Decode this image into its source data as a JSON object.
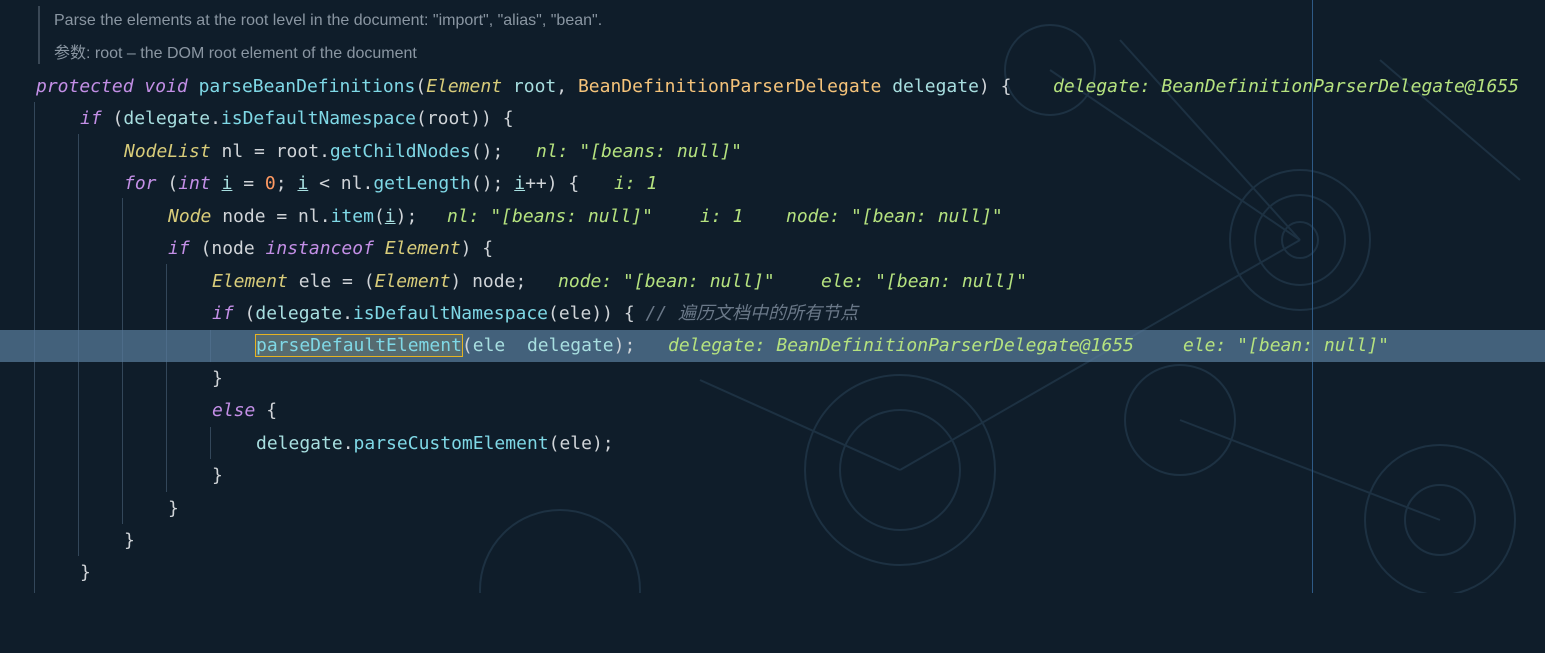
{
  "doc": {
    "line1": "Parse the elements at the root level in the document: \"import\", \"alias\", \"bean\".",
    "line2": "参数: root – the DOM root element of the document"
  },
  "code": {
    "l1": {
      "protected": "protected",
      "void": "void",
      "name": "parseBeanDefinitions",
      "open": "(",
      "type1": "Element",
      "p1": "root",
      "comma": ", ",
      "type2": "BeanDefinitionParserDelegate",
      "p2": "delegate",
      "close": ") {",
      "hint": "delegate: BeanDefinitionParserDelegate@1655"
    },
    "l2": {
      "if": "if",
      "open": " (",
      "obj": "delegate",
      "dot": ".",
      "call": "isDefaultNamespace",
      "args": "(root)) {"
    },
    "l3": {
      "type": "NodeList",
      "decl": " nl = root.",
      "call": "getChildNodes",
      "end": "();",
      "hint": "nl: \"[beans: null]\""
    },
    "l4": {
      "for": "for",
      "a": " (",
      "int": "int",
      "sp": " ",
      "i1": "i",
      "b": " = ",
      "zero": "0",
      "c": "; ",
      "i2": "i",
      "d": " < nl.",
      "call": "getLength",
      "e": "(); ",
      "i3": "i",
      "f": "++) {",
      "hint": "i: 1"
    },
    "l5": {
      "type": "Node",
      "decl": " node = nl.",
      "call": "item",
      "open": "(",
      "i": "i",
      "end": ");",
      "hint1": "nl: \"[beans: null]\"",
      "hint2": "i: 1",
      "hint3": "node: \"[bean: null]\""
    },
    "l6": {
      "if": "if",
      "a": " (node ",
      "instanceof": "instanceof",
      "sp": " ",
      "type": "Element",
      "end": ") {"
    },
    "l7": {
      "type": "Element",
      "a": " ele = (",
      "type2": "Element",
      "end": ") node;",
      "hint1": "node: \"[bean: null]\"",
      "hint2": "ele: \"[bean: null]\""
    },
    "l8": {
      "if": "if",
      "a": " (",
      "obj": "delegate",
      "dot": ".",
      "call": "isDefaultNamespace",
      "end": "(ele)) { ",
      "comment": "// 遍历文档中的所有节点"
    },
    "l9": {
      "call": "parseDefaultElement",
      "open": "(",
      "a1": "ele",
      "sep": "  ",
      "a2": "delegate",
      "end": ");",
      "hint1": "delegate: BeanDefinitionParserDelegate@1655",
      "hint2": "ele: \"[bean: null]\""
    },
    "l10": {
      "brace": "}"
    },
    "l11": {
      "else": "else",
      "brace": " {"
    },
    "l12": {
      "obj": "delegate",
      "dot": ".",
      "call": "parseCustomElement",
      "end": "(ele);"
    },
    "l13": {
      "brace": "}"
    },
    "l14": {
      "brace": "}"
    },
    "l15": {
      "brace": "}"
    },
    "l16": {
      "brace": "}"
    }
  }
}
